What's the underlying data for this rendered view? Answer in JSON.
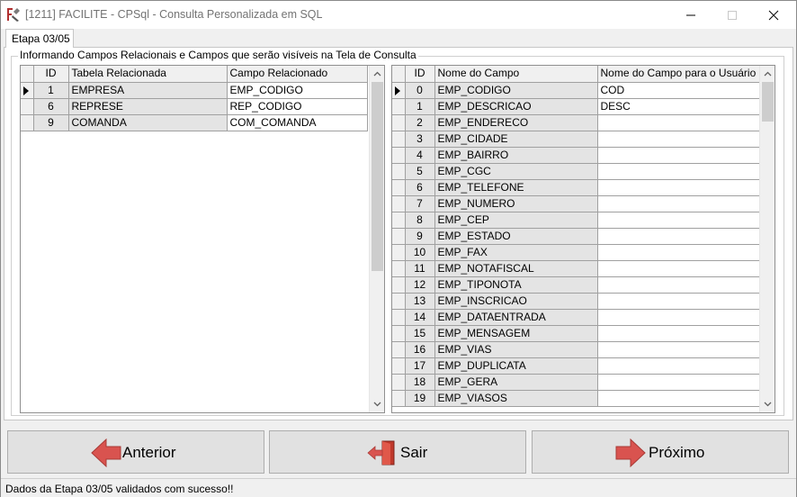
{
  "window": {
    "title": "[1211] FACILITE - CPSql - Consulta Personalizada em SQL"
  },
  "tab": {
    "label": "Etapa 03/05"
  },
  "group": {
    "label": "Informando Campos Relacionais e Campos que serão visíveis na Tela de Consulta"
  },
  "left_grid": {
    "headers": {
      "id": "ID",
      "table": "Tabela Relacionada",
      "field": "Campo Relacionado"
    },
    "rows": [
      {
        "id": "1",
        "table": "EMPRESA",
        "field": "EMP_CODIGO"
      },
      {
        "id": "6",
        "table": "REPRESE",
        "field": "REP_CODIGO"
      },
      {
        "id": "9",
        "table": "COMANDA",
        "field": "COM_COMANDA"
      }
    ]
  },
  "right_grid": {
    "headers": {
      "id": "ID",
      "name": "Nome do Campo",
      "user_name": "Nome do Campo para o Usuário"
    },
    "rows": [
      {
        "id": "0",
        "name": "EMP_CODIGO",
        "user_name": "COD"
      },
      {
        "id": "1",
        "name": "EMP_DESCRICAO",
        "user_name": "DESC"
      },
      {
        "id": "2",
        "name": "EMP_ENDERECO",
        "user_name": ""
      },
      {
        "id": "3",
        "name": "EMP_CIDADE",
        "user_name": ""
      },
      {
        "id": "4",
        "name": "EMP_BAIRRO",
        "user_name": ""
      },
      {
        "id": "5",
        "name": "EMP_CGC",
        "user_name": ""
      },
      {
        "id": "6",
        "name": "EMP_TELEFONE",
        "user_name": ""
      },
      {
        "id": "7",
        "name": "EMP_NUMERO",
        "user_name": ""
      },
      {
        "id": "8",
        "name": "EMP_CEP",
        "user_name": ""
      },
      {
        "id": "9",
        "name": "EMP_ESTADO",
        "user_name": ""
      },
      {
        "id": "10",
        "name": "EMP_FAX",
        "user_name": ""
      },
      {
        "id": "11",
        "name": "EMP_NOTAFISCAL",
        "user_name": ""
      },
      {
        "id": "12",
        "name": "EMP_TIPONOTA",
        "user_name": ""
      },
      {
        "id": "13",
        "name": "EMP_INSCRICAO",
        "user_name": ""
      },
      {
        "id": "14",
        "name": "EMP_DATAENTRADA",
        "user_name": ""
      },
      {
        "id": "15",
        "name": "EMP_MENSAGEM",
        "user_name": ""
      },
      {
        "id": "16",
        "name": "EMP_VIAS",
        "user_name": ""
      },
      {
        "id": "17",
        "name": "EMP_DUPLICATA",
        "user_name": ""
      },
      {
        "id": "18",
        "name": "EMP_GERA",
        "user_name": ""
      },
      {
        "id": "19",
        "name": "EMP_VIASOS",
        "user_name": ""
      }
    ]
  },
  "buttons": {
    "previous": {
      "label": "Anterior",
      "icon": "arrow-left-icon"
    },
    "exit": {
      "label": "Sair",
      "icon": "exit-door-icon"
    },
    "next": {
      "label": "Próximo",
      "icon": "arrow-right-icon"
    }
  },
  "status": {
    "text": "Dados da Etapa 03/05 validados com sucesso!!"
  },
  "colors": {
    "arrow_red": "#d9534f",
    "grid_line": "#a0a0a0",
    "fixed_column": "#e4e4e4"
  }
}
